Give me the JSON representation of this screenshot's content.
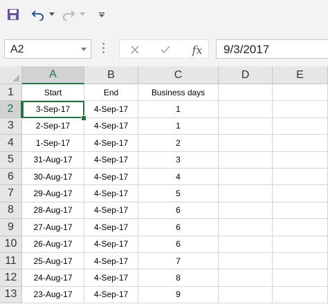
{
  "toolbar": {
    "icons": [
      "save-icon",
      "undo-icon",
      "redo-icon",
      "customize-icon"
    ],
    "accent": "#217346"
  },
  "formula_bar": {
    "name_box": "A2",
    "fx_label": "fx",
    "formula": "9/3/2017"
  },
  "sheet": {
    "columns": [
      "A",
      "B",
      "C",
      "D",
      "E"
    ],
    "rows": [
      "1",
      "2",
      "3",
      "4",
      "5",
      "6",
      "7",
      "8",
      "9",
      "10",
      "11",
      "12",
      "13"
    ],
    "cells": [
      [
        "Start",
        "End",
        "Business days",
        "",
        ""
      ],
      [
        "3-Sep-17",
        "4-Sep-17",
        "1",
        "",
        ""
      ],
      [
        "2-Sep-17",
        "4-Sep-17",
        "1",
        "",
        ""
      ],
      [
        "1-Sep-17",
        "4-Sep-17",
        "2",
        "",
        ""
      ],
      [
        "31-Aug-17",
        "4-Sep-17",
        "3",
        "",
        ""
      ],
      [
        "30-Aug-17",
        "4-Sep-17",
        "4",
        "",
        ""
      ],
      [
        "29-Aug-17",
        "4-Sep-17",
        "5",
        "",
        ""
      ],
      [
        "28-Aug-17",
        "4-Sep-17",
        "6",
        "",
        ""
      ],
      [
        "27-Aug-17",
        "4-Sep-17",
        "6",
        "",
        ""
      ],
      [
        "26-Aug-17",
        "4-Sep-17",
        "6",
        "",
        ""
      ],
      [
        "25-Aug-17",
        "4-Sep-17",
        "7",
        "",
        ""
      ],
      [
        "24-Aug-17",
        "4-Sep-17",
        "8",
        "",
        ""
      ],
      [
        "23-Aug-17",
        "4-Sep-17",
        "9",
        "",
        ""
      ]
    ],
    "selected_cell": "A2",
    "selected_col": "A",
    "selected_row": "2"
  }
}
